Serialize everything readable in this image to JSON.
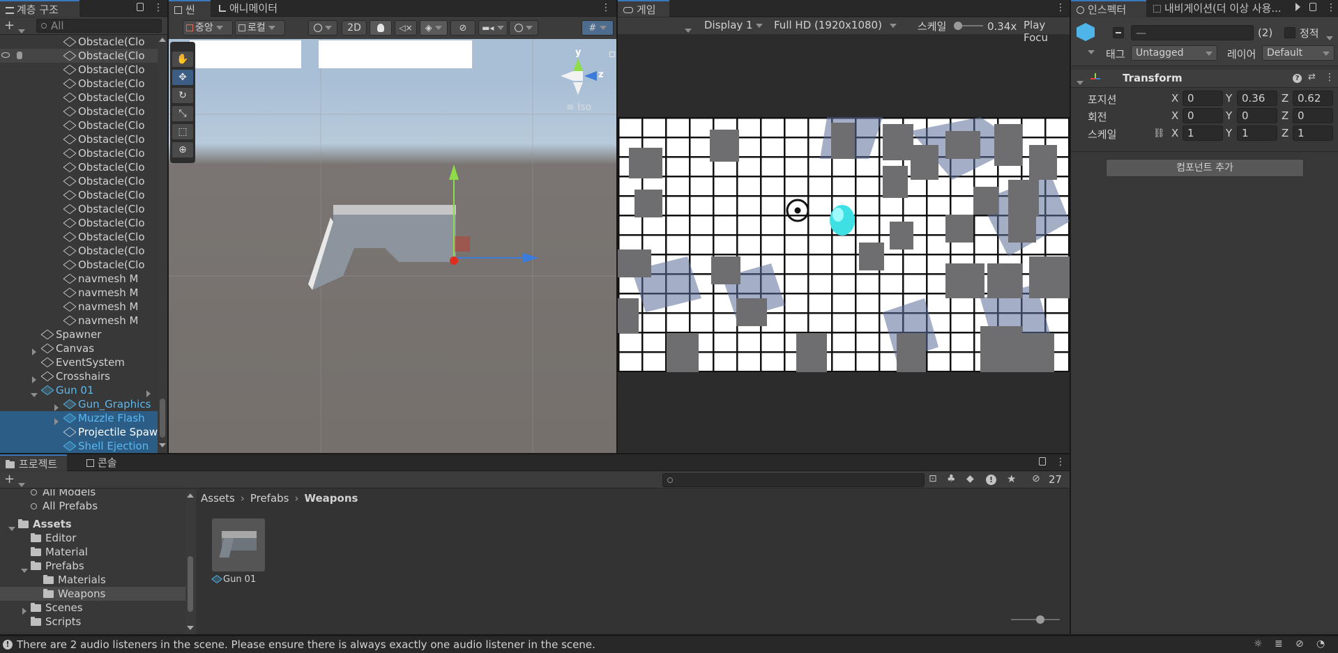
{
  "hierarchy": {
    "tab_label": "계층 구조",
    "search_placeholder": "All",
    "items": [
      {
        "label": "Obstacle(Clo",
        "indent": 1,
        "icon": "cube-icon"
      },
      {
        "label": "Obstacle(Clo",
        "indent": 1,
        "icon": "cube-icon"
      },
      {
        "label": "Obstacle(Clo",
        "indent": 1,
        "icon": "cube-icon"
      },
      {
        "label": "Obstacle(Clo",
        "indent": 1,
        "icon": "cube-icon"
      },
      {
        "label": "Obstacle(Clo",
        "indent": 1,
        "icon": "cube-icon"
      },
      {
        "label": "Obstacle(Clo",
        "indent": 1,
        "icon": "cube-icon"
      },
      {
        "label": "Obstacle(Clo",
        "indent": 1,
        "icon": "cube-icon"
      },
      {
        "label": "Obstacle(Clo",
        "indent": 1,
        "icon": "cube-icon"
      },
      {
        "label": "Obstacle(Clo",
        "indent": 1,
        "icon": "cube-icon"
      },
      {
        "label": "Obstacle(Clo",
        "indent": 1,
        "icon": "cube-icon"
      },
      {
        "label": "Obstacle(Clo",
        "indent": 1,
        "icon": "cube-icon"
      },
      {
        "label": "Obstacle(Clo",
        "indent": 1,
        "icon": "cube-icon"
      },
      {
        "label": "Obstacle(Clo",
        "indent": 1,
        "icon": "cube-icon"
      },
      {
        "label": "Obstacle(Clo",
        "indent": 1,
        "icon": "cube-icon"
      },
      {
        "label": "Obstacle(Clo",
        "indent": 1,
        "icon": "cube-icon"
      },
      {
        "label": "Obstacle(Clo",
        "indent": 1,
        "icon": "cube-icon"
      },
      {
        "label": "Obstacle(Clo",
        "indent": 1,
        "icon": "cube-icon"
      },
      {
        "label": "navmesh M",
        "indent": 1,
        "icon": "cube-icon"
      },
      {
        "label": "navmesh M",
        "indent": 1,
        "icon": "cube-icon"
      },
      {
        "label": "navmesh M",
        "indent": 1,
        "icon": "cube-icon"
      },
      {
        "label": "navmesh M",
        "indent": 1,
        "icon": "cube-icon"
      },
      {
        "label": "Spawner",
        "indent": 0,
        "icon": "cube-icon"
      },
      {
        "label": "Canvas",
        "indent": 0,
        "icon": "cube-icon",
        "expand": "right"
      },
      {
        "label": "EventSystem",
        "indent": 0,
        "icon": "cube-icon"
      },
      {
        "label": "Crosshairs",
        "indent": 0,
        "icon": "cube-icon",
        "expand": "right"
      },
      {
        "label": "Gun 01",
        "indent": 0,
        "icon": "prefab-cube-icon",
        "expand": "down",
        "prefab": true
      },
      {
        "label": "Gun_Graphics",
        "indent": 1,
        "icon": "prefab-cube-icon",
        "expand": "right",
        "prefab": true
      },
      {
        "label": "Muzzle Flash",
        "indent": 1,
        "icon": "prefab-cube-icon",
        "expand": "right",
        "prefab": true,
        "selected": true
      },
      {
        "label": "Projectile Spaw",
        "indent": 1,
        "icon": "cube-icon",
        "selected": true,
        "white": true
      },
      {
        "label": "Shell Ejection",
        "indent": 1,
        "icon": "prefab-cube-icon",
        "prefab": true,
        "selected": true
      }
    ]
  },
  "scene": {
    "tab_scene": "씬",
    "tab_animator": "애니메이터",
    "pivot_label": "중앙",
    "space_label": "로컬",
    "mode_2d": "2D",
    "gizmo_y": "y",
    "gizmo_z": "z",
    "projection_label": "Iso"
  },
  "game": {
    "tab_label": "게임",
    "display": "Display 1",
    "resolution": "Full HD (1920x1080)",
    "scale_label": "스케일",
    "scale_value": "0.34x",
    "play_focus": "Play Focu"
  },
  "inspector": {
    "tab_inspector": "인스펙터",
    "tab_navigation": "내비게이션(더 이상 사용...",
    "name_value": "—",
    "count": "(2)",
    "static_label": "정적",
    "tag_label": "태그",
    "tag_value": "Untagged",
    "layer_label": "레이어",
    "layer_value": "Default",
    "component_title": "Transform",
    "position_label": "포지션",
    "rotation_label": "회전",
    "scale_label": "스케일",
    "axis_x": "X",
    "axis_y": "Y",
    "axis_z": "Z",
    "position": {
      "x": "0",
      "y": "0.36",
      "z": "0.62"
    },
    "rotation": {
      "x": "0",
      "y": "0",
      "z": "0"
    },
    "scale": {
      "x": "1",
      "y": "1",
      "z": "1"
    },
    "add_component": "컴포넌트 추가"
  },
  "project": {
    "tab_project": "프로젝트",
    "tab_console": "콘솔",
    "hidden_count": "27",
    "tree": [
      {
        "label": "All Models",
        "indent": 2,
        "icon": "search-icon"
      },
      {
        "label": "All Prefabs",
        "indent": 2,
        "icon": "search-icon"
      },
      {
        "label": "Assets",
        "indent": 1,
        "icon": "folder-icon",
        "bold": true,
        "expand": "down"
      },
      {
        "label": "Editor",
        "indent": 2,
        "icon": "folder-icon"
      },
      {
        "label": "Material",
        "indent": 2,
        "icon": "folder-icon"
      },
      {
        "label": "Prefabs",
        "indent": 2,
        "icon": "folder-icon",
        "expand": "down"
      },
      {
        "label": "Materials",
        "indent": 3,
        "icon": "folder-icon"
      },
      {
        "label": "Weapons",
        "indent": 3,
        "icon": "folder-icon",
        "selected": true
      },
      {
        "label": "Scenes",
        "indent": 2,
        "icon": "folder-icon",
        "expand": "right"
      },
      {
        "label": "Scripts",
        "indent": 2,
        "icon": "folder-icon"
      }
    ],
    "breadcrumb": [
      "Assets",
      "Prefabs",
      "Weapons"
    ],
    "asset_label": "Gun 01"
  },
  "status": {
    "message": "There are 2 audio listeners in the scene. Please ensure there is always exactly one audio listener in the scene."
  }
}
